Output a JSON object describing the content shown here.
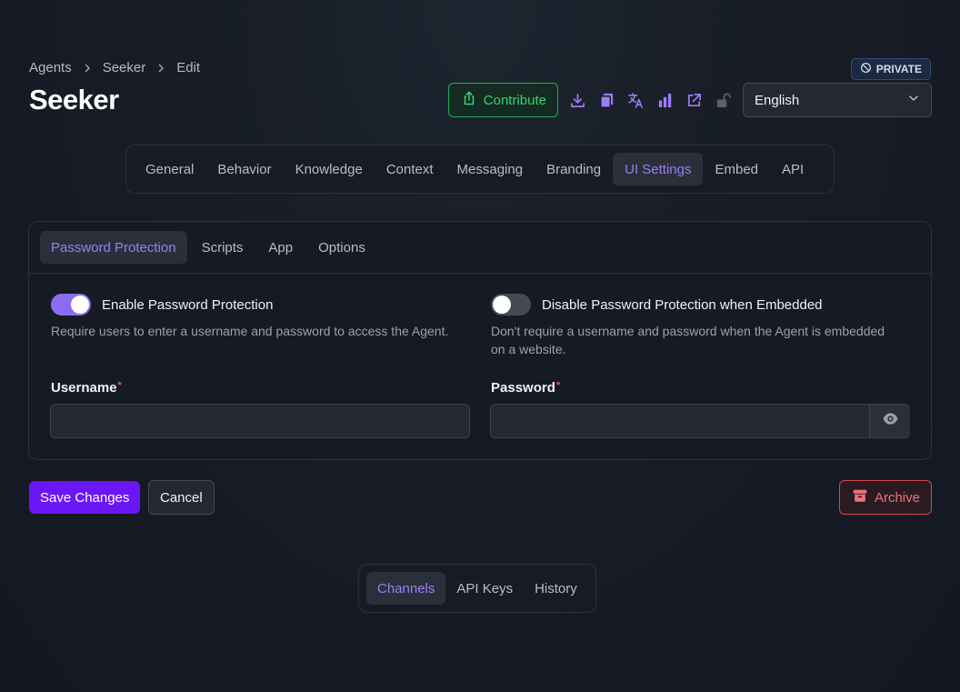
{
  "breadcrumb": [
    "Agents",
    "Seeker",
    "Edit"
  ],
  "page_title": "Seeker",
  "visibility_badge": "PRIVATE",
  "toolbar": {
    "contribute_label": "Contribute",
    "icons": [
      "download-icon",
      "copy-icon",
      "translate-icon",
      "analytics-icon",
      "external-link-icon",
      "unlock-icon"
    ],
    "language": "English"
  },
  "main_tabs": [
    "General",
    "Behavior",
    "Knowledge",
    "Context",
    "Messaging",
    "Branding",
    "UI Settings",
    "Embed",
    "API"
  ],
  "main_tabs_active": "UI Settings",
  "sub_tabs": [
    "Password Protection",
    "Scripts",
    "App",
    "Options"
  ],
  "sub_tabs_active": "Password Protection",
  "password_protection": {
    "enable_label": "Enable Password Protection",
    "enable_description": "Require users to enter a username and password to access the Agent.",
    "enable_on": true,
    "disable_embedded_label": "Disable Password Protection when Embedded",
    "disable_embedded_description": "Don't require a username and password when the Agent is embedded on a website.",
    "disable_embedded_on": false,
    "username_label": "Username",
    "username_value": "",
    "password_label": "Password",
    "password_value": "",
    "required_mark": "*"
  },
  "actions": {
    "save_label": "Save Changes",
    "cancel_label": "Cancel",
    "archive_label": "Archive"
  },
  "bottom_tabs": [
    "Channels",
    "API Keys",
    "History"
  ],
  "bottom_tabs_active": "Channels",
  "colors": {
    "accent_purple": "#8b6cf0",
    "primary_button": "#6b16f5",
    "contribute_green": "#3ad374",
    "archive_red": "#f07179",
    "background": "#171c25"
  }
}
